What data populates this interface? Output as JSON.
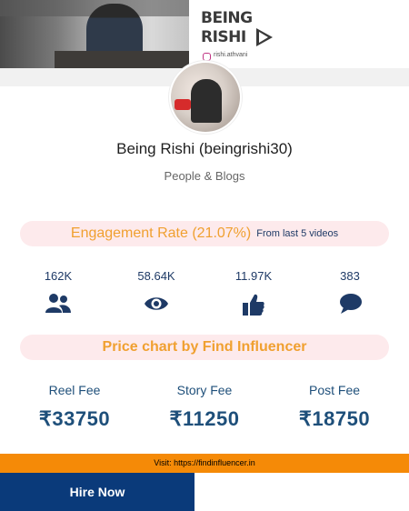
{
  "banner": {
    "logo_line1": "BEING",
    "logo_line2": "RISHI",
    "instagram_handle": "rishi.athvani"
  },
  "profile": {
    "name": "Being Rishi (beingrishi30)",
    "category": "People & Blogs"
  },
  "engagement": {
    "rate_label": "Engagement Rate (21.07%)",
    "note": "From last 5 videos"
  },
  "stats": [
    {
      "value": "162K",
      "icon": "users-icon"
    },
    {
      "value": "58.64K",
      "icon": "eye-icon"
    },
    {
      "value": "11.97K",
      "icon": "thumbs-up-icon"
    },
    {
      "value": "383",
      "icon": "comment-icon"
    }
  ],
  "pricing": {
    "title": "Price chart by Find Influencer",
    "fees": [
      {
        "label": "Reel Fee",
        "amount": "₹33750"
      },
      {
        "label": "Story Fee",
        "amount": "₹11250"
      },
      {
        "label": "Post Fee",
        "amount": "₹18750"
      }
    ]
  },
  "footer": {
    "visit_text": "Visit: https://findinfluencer.in",
    "hire_button": "Hire Now"
  },
  "colors": {
    "accent_orange": "#f0a030",
    "navy": "#1e3a66",
    "button_navy": "#0a3a7a",
    "pill_pink": "#fdeaec",
    "footer_orange": "#f58a07"
  }
}
